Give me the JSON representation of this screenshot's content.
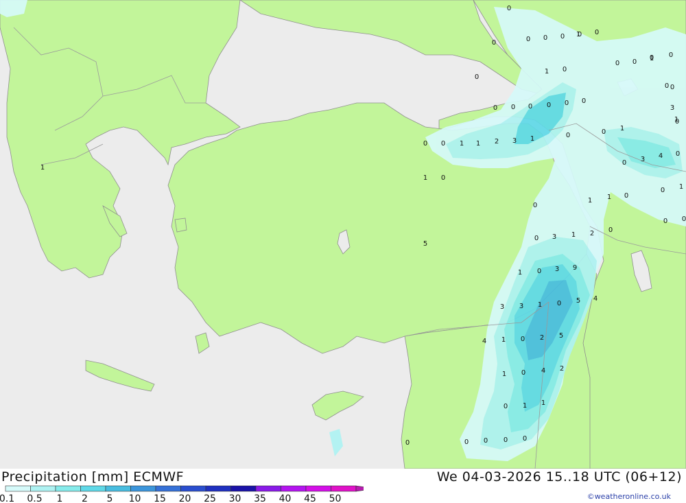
{
  "title": "Precipitation [mm] ECMWF",
  "timestamp": "We 04-03-2026 15..18 UTC (06+12)",
  "credit": "©weatheronline.co.uk",
  "colors": {
    "land": "#c2f59a",
    "sea": "#ececec",
    "border": "#9a9a9a"
  },
  "legend": {
    "labels": [
      "0.1",
      "0.5",
      "1",
      "2",
      "5",
      "10",
      "15",
      "20",
      "25",
      "30",
      "35",
      "40",
      "45",
      "50"
    ],
    "colors": [
      "#d6fafa",
      "#aef2f2",
      "#86ebeb",
      "#5fd9e8",
      "#48bde0",
      "#3c96dc",
      "#3571d8",
      "#2a4ecf",
      "#1f30c0",
      "#1a12a8",
      "#8a1ae8",
      "#b414f0",
      "#d40fe8",
      "#e011c8",
      "#b81bb0"
    ]
  },
  "map_values": [
    "0",
    "0",
    "0",
    "0",
    "0",
    "0",
    "0",
    "0",
    "0",
    "0",
    "1",
    "0",
    "0",
    "1",
    "0",
    "0",
    "0",
    "0",
    "0",
    "0",
    "0",
    "3",
    "0",
    "0",
    "1",
    "0",
    "0",
    "1",
    "1",
    "2",
    "3",
    "1",
    "0",
    "0",
    "3",
    "4",
    "0",
    "1",
    "0",
    "0",
    "1",
    "1",
    "1",
    "0",
    "0",
    "0",
    "0",
    "1",
    "2",
    "0",
    "0",
    "3",
    "5",
    "1",
    "0",
    "3",
    "9",
    "3",
    "3",
    "1",
    "0",
    "5",
    "4",
    "4",
    "1",
    "0",
    "2",
    "5",
    "1",
    "0",
    "4",
    "2",
    "0",
    "1",
    "1",
    "0",
    "0",
    "0",
    "0",
    "0",
    "1",
    "1",
    "0",
    "1",
    "0"
  ]
}
